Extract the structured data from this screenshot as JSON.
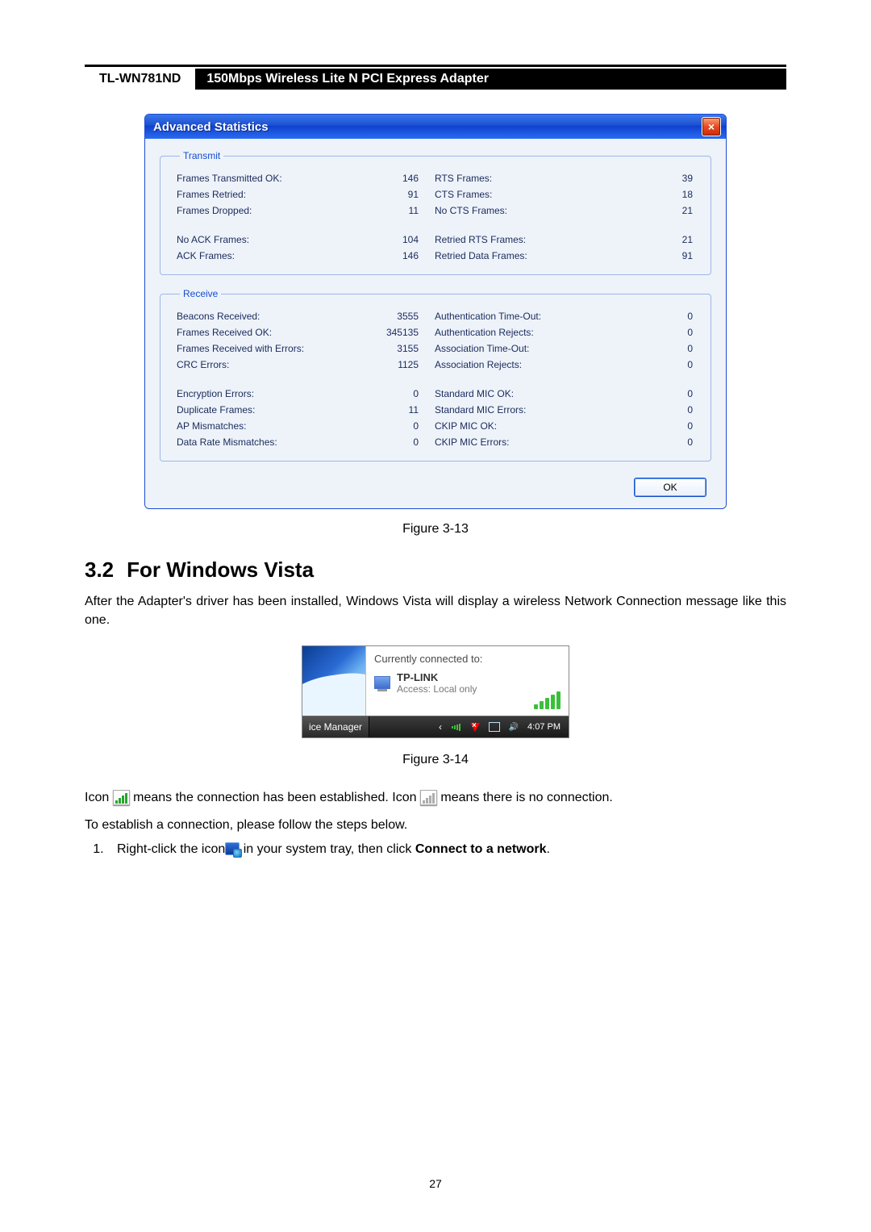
{
  "header": {
    "model": "TL-WN781ND",
    "desc": "150Mbps Wireless Lite N PCI Express Adapter"
  },
  "win": {
    "title": "Advanced Statistics",
    "ok": "OK",
    "groups": {
      "transmit": {
        "legend": "Transmit",
        "rows1": [
          [
            "Frames Transmitted OK:",
            "146",
            "RTS Frames:",
            "39"
          ],
          [
            "Frames Retried:",
            "91",
            "CTS Frames:",
            "18"
          ],
          [
            "Frames Dropped:",
            "11",
            "No CTS Frames:",
            "21"
          ]
        ],
        "rows2": [
          [
            "No ACK Frames:",
            "104",
            "Retried RTS Frames:",
            "21"
          ],
          [
            "ACK Frames:",
            "146",
            "Retried Data Frames:",
            "91"
          ]
        ]
      },
      "receive": {
        "legend": "Receive",
        "rows1": [
          [
            "Beacons Received:",
            "3555",
            "Authentication Time-Out:",
            "0"
          ],
          [
            "Frames Received OK:",
            "345135",
            "Authentication Rejects:",
            "0"
          ],
          [
            "Frames Received with Errors:",
            "3155",
            "Association Time-Out:",
            "0"
          ],
          [
            "CRC Errors:",
            "1125",
            "Association Rejects:",
            "0"
          ]
        ],
        "rows2": [
          [
            "Encryption Errors:",
            "0",
            "Standard MIC OK:",
            "0"
          ],
          [
            "Duplicate Frames:",
            "11",
            "Standard MIC Errors:",
            "0"
          ],
          [
            "AP Mismatches:",
            "0",
            "CKIP MIC OK:",
            "0"
          ],
          [
            "Data Rate Mismatches:",
            "0",
            "CKIP MIC Errors:",
            "0"
          ]
        ]
      }
    }
  },
  "fig13": "Figure 3-13",
  "section": {
    "num": "3.2",
    "title": "For Windows Vista"
  },
  "para1": "After the Adapter's driver has been installed, Windows Vista will display a wireless Network Connection message like this one.",
  "vista": {
    "hdr": "Currently connected to:",
    "name": "TP-LINK",
    "access": "Access:  Local only",
    "taskbtn": "ice Manager",
    "time": "4:07 PM"
  },
  "fig14": "Figure 3-14",
  "body": {
    "t1": "Icon ",
    "t2": "  means the connection has been established. Icon ",
    "t3": "  means there is no connection.",
    "line2": "To establish a connection, please follow the steps below.",
    "step1a": "Right-click the icon",
    "step1b": "  in your system tray, then click ",
    "step1bold": "Connect to a network",
    "step1c": "."
  },
  "pagenum": "27"
}
